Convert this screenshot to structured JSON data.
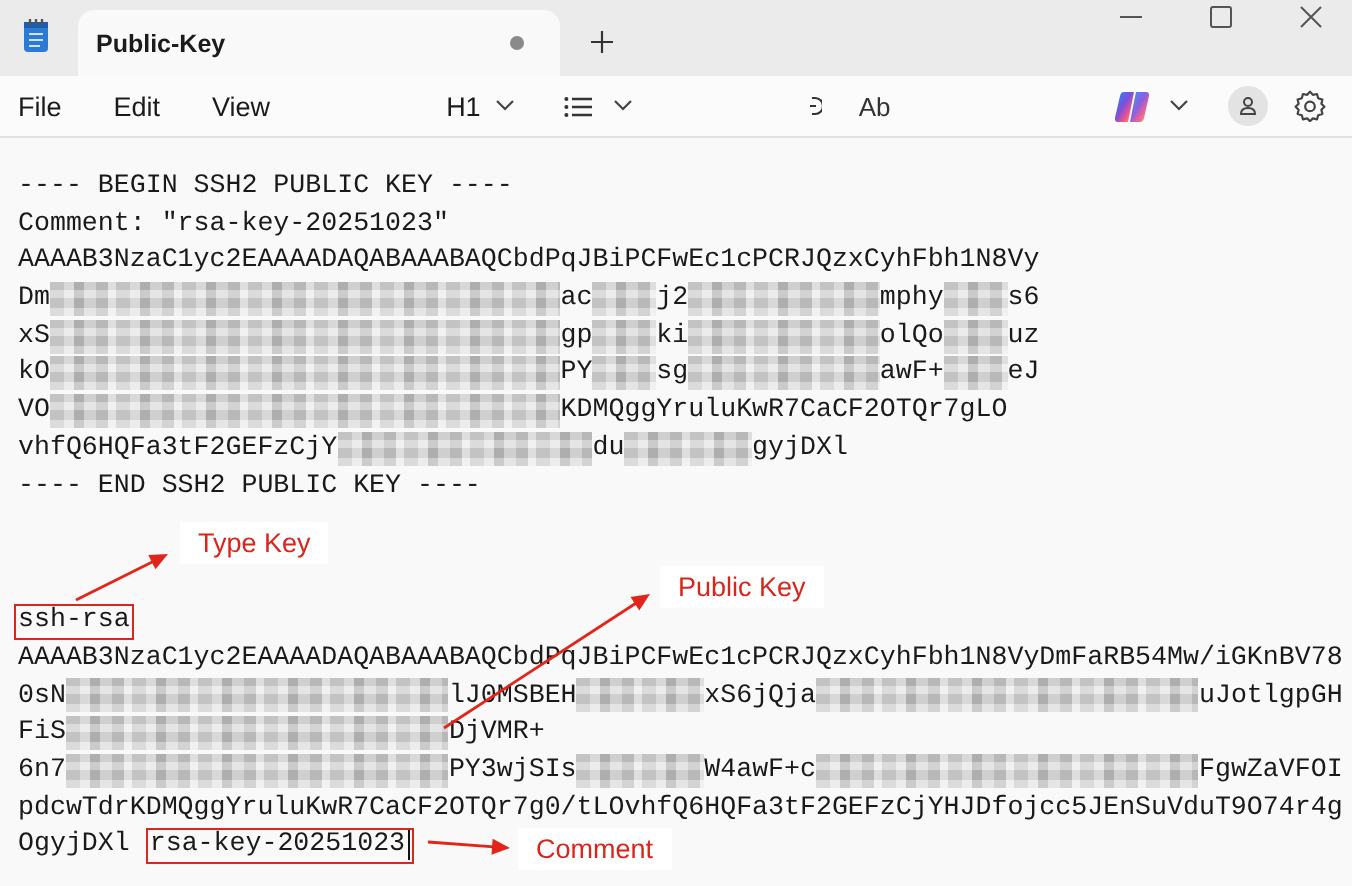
{
  "window": {
    "title": "Public-Key",
    "unsaved": true
  },
  "menu": [
    "File",
    "Edit",
    "View"
  ],
  "toolbar": {
    "heading": "H1",
    "spell_label": "Ab"
  },
  "sections": [
    {
      "lines": [
        {
          "segments": [
            {
              "kind": "text",
              "text": "---- BEGIN SSH2 PUBLIC KEY ----"
            }
          ]
        },
        {
          "segments": [
            {
              "kind": "text",
              "text": "Comment: \"rsa-key-20251023\""
            }
          ]
        },
        {
          "segments": [
            {
              "kind": "text",
              "text": "AAAAB3NzaC1yc2EAAAADAQABAAABAQCbdPqJBiPCFwEc1cPCRJQzxCyhFbh1N8Vy"
            }
          ]
        },
        {
          "segments": [
            {
              "kind": "text",
              "text": "Dm"
            },
            {
              "kind": "blur"
            },
            {
              "kind": "blur"
            },
            {
              "kind": "blur"
            },
            {
              "kind": "blur"
            },
            {
              "kind": "blur"
            },
            {
              "kind": "blur"
            },
            {
              "kind": "blur"
            },
            {
              "kind": "blur"
            },
            {
              "kind": "text",
              "text": "ac"
            },
            {
              "kind": "blur"
            },
            {
              "kind": "text",
              "text": "j2"
            },
            {
              "kind": "blur"
            },
            {
              "kind": "blur"
            },
            {
              "kind": "blur"
            },
            {
              "kind": "text",
              "text": "mphy"
            },
            {
              "kind": "blur"
            },
            {
              "kind": "text",
              "text": "s6"
            }
          ]
        },
        {
          "segments": [
            {
              "kind": "text",
              "text": "xS"
            },
            {
              "kind": "blur"
            },
            {
              "kind": "blur"
            },
            {
              "kind": "blur"
            },
            {
              "kind": "blur"
            },
            {
              "kind": "blur"
            },
            {
              "kind": "blur"
            },
            {
              "kind": "blur"
            },
            {
              "kind": "blur"
            },
            {
              "kind": "text",
              "text": "gp"
            },
            {
              "kind": "blur"
            },
            {
              "kind": "text",
              "text": "ki"
            },
            {
              "kind": "blur"
            },
            {
              "kind": "blur"
            },
            {
              "kind": "blur"
            },
            {
              "kind": "text",
              "text": "olQo"
            },
            {
              "kind": "blur"
            },
            {
              "kind": "text",
              "text": "uz"
            }
          ]
        },
        {
          "segments": [
            {
              "kind": "text",
              "text": "kO"
            },
            {
              "kind": "blur"
            },
            {
              "kind": "blur"
            },
            {
              "kind": "blur"
            },
            {
              "kind": "blur"
            },
            {
              "kind": "blur"
            },
            {
              "kind": "blur"
            },
            {
              "kind": "blur"
            },
            {
              "kind": "blur"
            },
            {
              "kind": "text",
              "text": "PY"
            },
            {
              "kind": "blur"
            },
            {
              "kind": "text",
              "text": "sg"
            },
            {
              "kind": "blur"
            },
            {
              "kind": "blur"
            },
            {
              "kind": "blur"
            },
            {
              "kind": "text",
              "text": "awF+"
            },
            {
              "kind": "blur"
            },
            {
              "kind": "text",
              "text": "eJ"
            }
          ]
        },
        {
          "segments": [
            {
              "kind": "text",
              "text": "VO"
            },
            {
              "kind": "blur"
            },
            {
              "kind": "blur"
            },
            {
              "kind": "blur"
            },
            {
              "kind": "blur"
            },
            {
              "kind": "blur"
            },
            {
              "kind": "blur"
            },
            {
              "kind": "blur"
            },
            {
              "kind": "blur"
            },
            {
              "kind": "text",
              "text": "KDMQggYruluKwR7CaCF2OTQr7g"
            },
            {
              "kind": "text",
              "text": "LO"
            }
          ]
        },
        {
          "segments": [
            {
              "kind": "text",
              "text": "vhfQ6HQFa3tF2GEFzCjY"
            },
            {
              "kind": "blur"
            },
            {
              "kind": "blur"
            },
            {
              "kind": "blur"
            },
            {
              "kind": "blur"
            },
            {
              "kind": "text",
              "text": "du"
            },
            {
              "kind": "blur"
            },
            {
              "kind": "blur"
            },
            {
              "kind": "text",
              "text": "gyjDXl"
            }
          ]
        },
        {
          "segments": [
            {
              "kind": "text",
              "text": "---- END SSH2 PUBLIC KEY ----"
            }
          ]
        }
      ]
    },
    {
      "lines": [
        {
          "segments": [
            {
              "kind": "text",
              "text": "ssh-rsa",
              "boxed": true
            }
          ]
        },
        {
          "segments": [
            {
              "kind": "text",
              "text": "AAAAB3NzaC1yc2EAAAADAQABAAABAQCbdPqJBiPCFwEc1cPCRJQzxCyhFbh1N8VyDmFaRB54Mw/iGKnBV78"
            }
          ]
        },
        {
          "segments": [
            {
              "kind": "text",
              "text": "0sN"
            },
            {
              "kind": "blur"
            },
            {
              "kind": "blur"
            },
            {
              "kind": "blur"
            },
            {
              "kind": "blur"
            },
            {
              "kind": "blur"
            },
            {
              "kind": "blur"
            },
            {
              "kind": "text",
              "text": "lJ0MSBEH"
            },
            {
              "kind": "blur"
            },
            {
              "kind": "blur"
            },
            {
              "kind": "text",
              "text": "xS6jQja"
            },
            {
              "kind": "blur"
            },
            {
              "kind": "blur"
            },
            {
              "kind": "blur"
            },
            {
              "kind": "blur"
            },
            {
              "kind": "blur"
            },
            {
              "kind": "blur"
            },
            {
              "kind": "text",
              "text": "uJotlgpGH"
            }
          ]
        },
        {
          "segments": [
            {
              "kind": "text",
              "text": "FiS"
            },
            {
              "kind": "blur"
            },
            {
              "kind": "blur"
            },
            {
              "kind": "blur"
            },
            {
              "kind": "blur"
            },
            {
              "kind": "blur"
            },
            {
              "kind": "blur"
            },
            {
              "kind": "text",
              "text": "DjVMR+"
            }
          ]
        },
        {
          "segments": [
            {
              "kind": "text",
              "text": "6n7"
            },
            {
              "kind": "blur"
            },
            {
              "kind": "blur"
            },
            {
              "kind": "blur"
            },
            {
              "kind": "blur"
            },
            {
              "kind": "blur"
            },
            {
              "kind": "blur"
            },
            {
              "kind": "text",
              "text": "PY3wjSIs"
            },
            {
              "kind": "blur"
            },
            {
              "kind": "blur"
            },
            {
              "kind": "text",
              "text": "W4awF+c"
            },
            {
              "kind": "blur"
            },
            {
              "kind": "blur"
            },
            {
              "kind": "blur"
            },
            {
              "kind": "blur"
            },
            {
              "kind": "blur"
            },
            {
              "kind": "blur"
            },
            {
              "kind": "text",
              "text": "FgwZaVFOI"
            }
          ]
        },
        {
          "segments": [
            {
              "kind": "text",
              "text": "pdcwTdrKDMQggYruluKwR7CaCF2OTQr7g0/tLOvhfQ6HQFa3tF2GEFzCjYHJDfojcc5JEnSuVduT9O74r4g"
            }
          ]
        },
        {
          "segments": [
            {
              "kind": "text",
              "text": "OgyjDXl"
            },
            {
              "kind": "text",
              "text": "rsa-key-20251023",
              "boxed": true,
              "cursor": true
            }
          ]
        }
      ]
    }
  ],
  "annotations": [
    {
      "label": "Type Key"
    },
    {
      "label": "Public Key"
    },
    {
      "label": "Comment"
    }
  ]
}
